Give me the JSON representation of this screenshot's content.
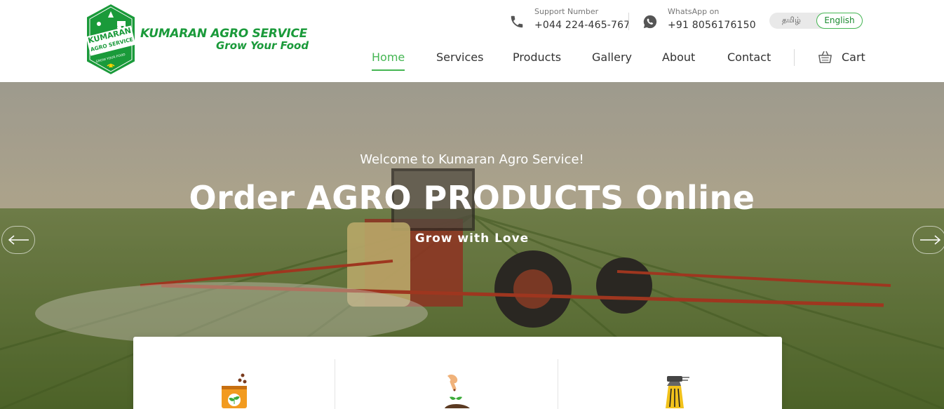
{
  "brand": {
    "name": "KUMARAN AGRO SERVICE",
    "tagline": "Grow Your Food",
    "badge_line1": "KUMARAN",
    "badge_line2": "AGRO SERVICE",
    "badge_line3": "GROW YOUR FOOD",
    "color": "#1a9a3a"
  },
  "contacts": {
    "support": {
      "label": "Support Number",
      "value": "+044 224-465-767",
      "icon": "phone-icon"
    },
    "whatsapp": {
      "label": "WhatsApp on",
      "value": "+91 8056176150",
      "icon": "whatsapp-icon"
    }
  },
  "language": {
    "options": [
      "தமிழ்",
      "English"
    ],
    "selected": "English"
  },
  "nav": {
    "items": [
      "Home",
      "Services",
      "Products",
      "Gallery",
      "About",
      "Contact"
    ],
    "active": "Home",
    "cart_label": "Cart",
    "accent": "#45b653"
  },
  "hero": {
    "welcome": "Welcome to Kumaran Agro Service!",
    "title": "Order AGRO PRODUCTS Online",
    "subtitle": "Grow with Love"
  },
  "features": {
    "icons": [
      "fertilizer-bag-icon",
      "seed-planting-icon",
      "sprayer-bottle-icon"
    ]
  }
}
